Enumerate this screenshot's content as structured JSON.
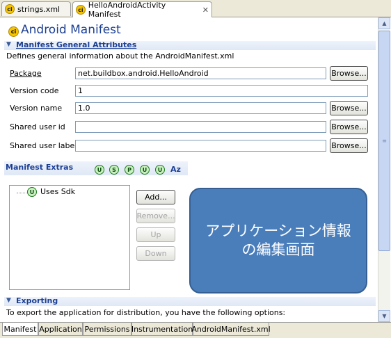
{
  "tabs_top": [
    {
      "label": "strings.xml",
      "icon": "android-file-icon"
    },
    {
      "label": "HelloAndroidActivity Manifest",
      "icon": "android-file-icon",
      "close": "✕"
    }
  ],
  "page": {
    "title": "Android Manifest",
    "icon_glyph": "ci"
  },
  "general": {
    "header": "Manifest General Attributes",
    "description": "Defines general information about the AndroidManifest.xml",
    "fields": [
      {
        "label": "Package",
        "value": "net.buildbox.android.HelloAndroid",
        "browse": "Browse..."
      },
      {
        "label": "Version code",
        "value": "1"
      },
      {
        "label": "Version name",
        "value": "1.0",
        "browse": "Browse..."
      },
      {
        "label": "Shared user id",
        "value": "",
        "browse": "Browse..."
      },
      {
        "label": "Shared user label",
        "value": "",
        "browse": "Browse..."
      }
    ]
  },
  "extras": {
    "header": "Manifest Extras",
    "toolbar_icons": [
      "U",
      "S",
      "P",
      "U",
      "U"
    ],
    "sort_label": "Az",
    "tree_item": {
      "icon": "U",
      "label": "Uses Sdk"
    },
    "buttons": {
      "add": "Add...",
      "remove": "Remove...",
      "up": "Up",
      "down": "Down"
    }
  },
  "callout": {
    "line1": "アプリケーション情報",
    "line2": "の編集画面"
  },
  "exporting": {
    "header": "Exporting",
    "description": "To export the application for distribution, you have the following options:"
  },
  "tabs_bottom": [
    "Manifest",
    "Application",
    "Permissions",
    "Instrumentation",
    "AndroidManifest.xml"
  ],
  "colors": {
    "section_blue": "#1c3f94",
    "callout_fill": "#4a7ebb",
    "icon_green": "#1e7a1e"
  }
}
